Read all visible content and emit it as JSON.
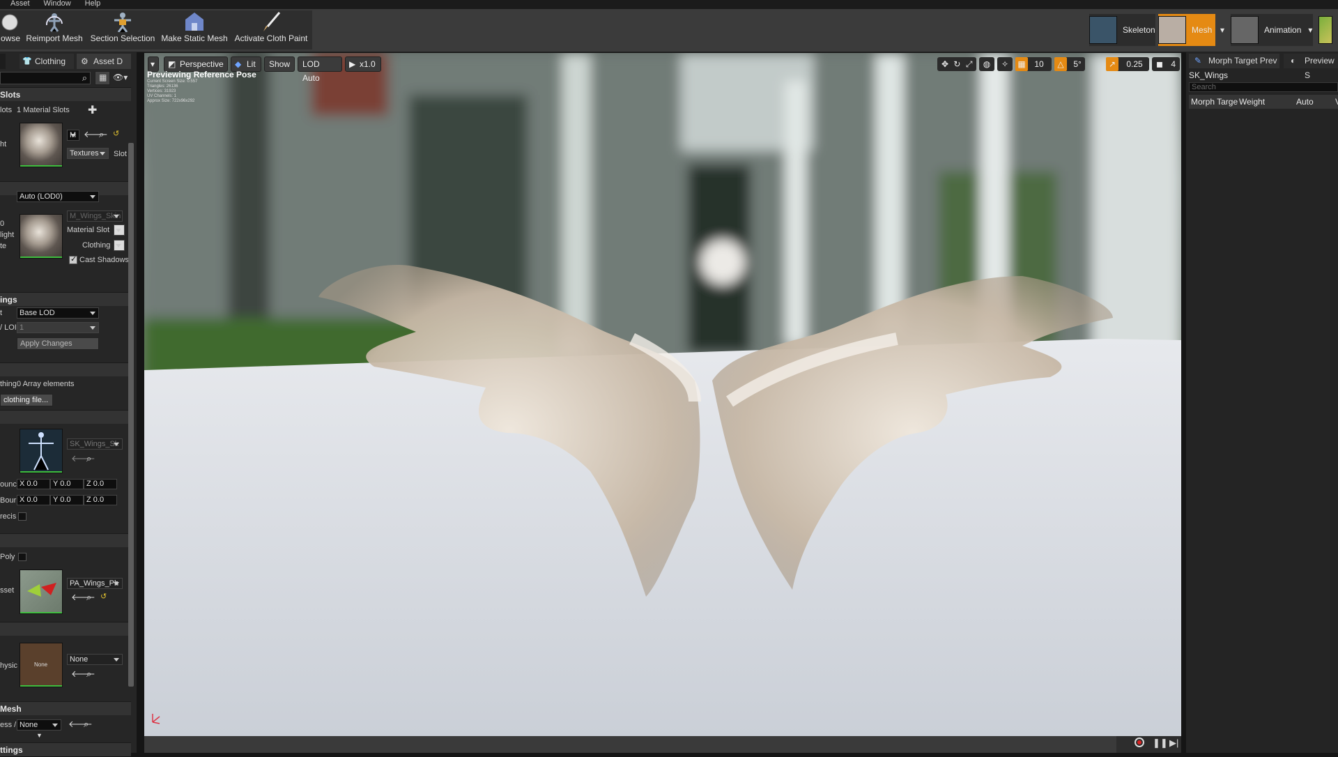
{
  "menu": [
    "Asset",
    "Window",
    "Help"
  ],
  "toolbar": {
    "browse": "owse",
    "reimport": "Reimport Mesh",
    "section_selection": "Section Selection",
    "make_static": "Make Static Mesh",
    "activate_cloth": "Activate Cloth Paint"
  },
  "modes": {
    "skeleton": "Skeleton",
    "mesh": "Mesh",
    "animation": "Animation",
    "accent": "#e58a13"
  },
  "left": {
    "tabs": [
      "Clothing",
      "Asset D"
    ],
    "material_slots_header": "Slots",
    "slots_label": "lots",
    "slots_count": "1 Material Slots",
    "ht_label": "ht",
    "textures": "Textures",
    "slot_label": "Slot",
    "lod_dropdown": "Auto (LOD0)",
    "lod_label": "0",
    "light_label": "light",
    "te_label": "te",
    "mat_name": "M_Wings_Skin",
    "material_slot": "Material Slot",
    "clothing": "Clothing",
    "cast_shadows": "Cast Shadows",
    "settings_header": "ings",
    "t_label": "t",
    "base_lod": "Base LOD",
    "lod_input_label": "/ LOI",
    "lod_input_value": "1",
    "apply_changes": "Apply Changes",
    "thing_label": "thing",
    "array_elements": "0 Array elements",
    "clothing_file": "clothing file...",
    "skeleton_asset": "SK_Wings_Sk",
    "bounds1_label": "ounc",
    "bounds2_label": "Bour",
    "vec": [
      "X",
      "0.0",
      "Y",
      "0.0",
      "Z",
      "0.0"
    ],
    "precis_label": "recis",
    "poly_label": "Poly",
    "asset_label": "sset",
    "physics_asset": "PA_Wings_Ph",
    "physic_label": "hysic",
    "none": "None",
    "mesh_header": "Mesh",
    "ess_label": "ess /",
    "settings2_header": "ttings"
  },
  "viewport": {
    "perspective": "Perspective",
    "lit": "Lit",
    "show": "Show",
    "lod_auto": "LOD Auto",
    "play_speed": "x1.0",
    "grid_value": "10",
    "rotation_value": "5°",
    "scale_value": "0.25",
    "camera_speed": "4",
    "previewing": "Previewing Reference Pose",
    "stats": [
      "Current Screen Size: 0.557",
      "Triangles: 26136",
      "Vertices: 31923",
      "UV Channels: 1",
      "Approx Size: 722x96x292"
    ]
  },
  "right": {
    "tabs": [
      "Morph Target Prev",
      "Preview S"
    ],
    "asset_name": "SK_Wings",
    "search_placeholder": "Search",
    "columns": [
      "Morph Targe",
      "Weight",
      "Auto",
      "V"
    ]
  }
}
